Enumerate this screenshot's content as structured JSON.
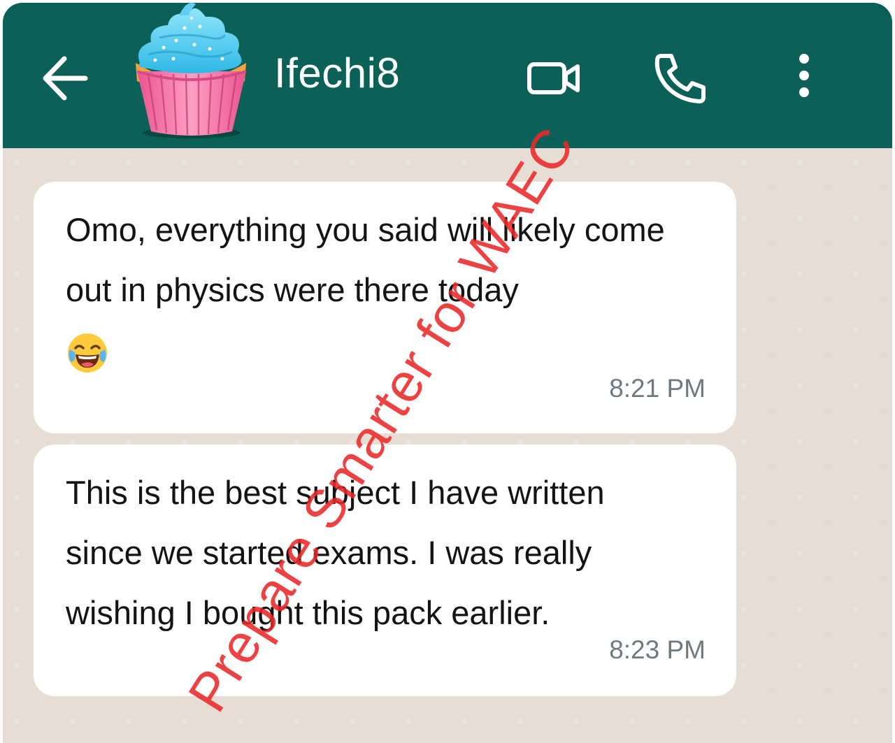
{
  "header": {
    "contact_name": "Ifechi8",
    "background_color": "#0b6157",
    "back_icon": "arrow-left-icon",
    "avatar_icon": "cupcake-avatar",
    "video_icon": "video-camera-icon",
    "call_icon": "phone-icon",
    "menu_icon": "more-vertical-icon"
  },
  "messages": [
    {
      "text": "Omo, everything you said will likely come out in physics were there today",
      "emoji": "😂",
      "time": "8:21 PM"
    },
    {
      "text": "This is the best subject I have written since we started exams. I was really wishing I bought this pack earlier.",
      "time": "8:23 PM"
    }
  ],
  "watermark": {
    "text": "Prepare Smarter for WAEC",
    "color": "#ec2828"
  },
  "colors": {
    "chat_background": "#e6ddd4",
    "bubble": "#ffffff",
    "timestamp": "#6f7a80"
  }
}
